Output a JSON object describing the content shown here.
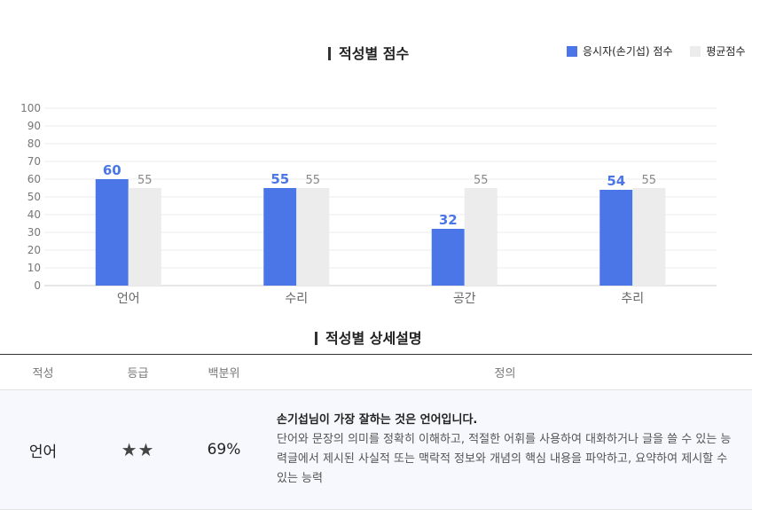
{
  "chart_section": {
    "title": "적성별 점수"
  },
  "legend": [
    {
      "label": "응시자(손기섭) 점수",
      "color": "#4a76e8"
    },
    {
      "label": "평균점수",
      "color": "#ececec"
    }
  ],
  "chart_data": {
    "type": "bar",
    "title": "적성별 점수",
    "categories": [
      "언어",
      "수리",
      "공간",
      "추리"
    ],
    "series": [
      {
        "name": "응시자(손기섭) 점수",
        "color": "#4a76e8",
        "values": [
          60,
          55,
          32,
          54
        ]
      },
      {
        "name": "평균점수",
        "color": "#ececec",
        "values": [
          55,
          55,
          55,
          55
        ]
      }
    ],
    "ylim": [
      0,
      100
    ],
    "yticks": [
      0,
      10,
      20,
      30,
      40,
      50,
      60,
      70,
      80,
      90,
      100
    ],
    "grid": true,
    "legend_position": "top-right"
  },
  "detail_section": {
    "title": "적성별 상세설명",
    "headers": [
      "적성",
      "등급",
      "백분위",
      "정의"
    ],
    "row": {
      "name": "언어",
      "grade": "★★",
      "percentile": "69%",
      "lead": "손기섭님이 가장 잘하는 것은 언어입니다.",
      "definition": "단어와 문장의 의미를 정확히 이해하고, 적절한 어휘를 사용하여 대화하거나 글을 쓸 수 있는 능력글에서 제시된 사실적 또는 맥락적 정보와 개념의 핵심 내용을 파악하고, 요약하여 제시할 수 있는 능력"
    }
  }
}
